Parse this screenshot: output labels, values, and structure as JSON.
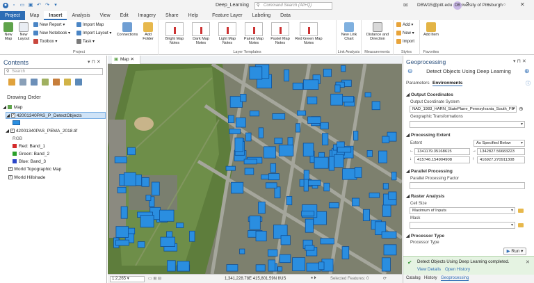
{
  "window": {
    "title": "Deep_Learning",
    "search_placeholder": "Command Search (Alt+Q)",
    "user": "DBW15@pitt.edu - University of Pittsburgh",
    "avatar_initials": "DB"
  },
  "ribbon_tabs": [
    "Project",
    "Map",
    "Insert",
    "Analysis",
    "View",
    "Edit",
    "Imagery",
    "Share",
    "Help",
    "Feature Layer",
    "Labeling",
    "Data"
  ],
  "active_tab": "Insert",
  "ribbon": {
    "project": {
      "new_map": "New Map",
      "new_layout": "New Layout",
      "new_report": "New Report",
      "new_notebook": "New Notebook",
      "toolbox": "Toolbox",
      "import_map": "Import Map",
      "import_layout": "Import Layout",
      "task": "Task",
      "connections": "Connections",
      "add_folder": "Add Folder",
      "group_label": "Project"
    },
    "layer_templates": {
      "items": [
        "Bright Map Notes",
        "Dark Map Notes",
        "Light Map Notes",
        "Paired Map Notes",
        "Pastel Map Notes",
        "Red Green Map Notes"
      ],
      "group_label": "Layer Templates"
    },
    "link_analysis": {
      "new_link_chart": "New Link Chart",
      "group_label": "Link Analysis"
    },
    "measurements": {
      "distance_direction": "Distance and Direction",
      "group_label": "Measurements"
    },
    "styles": {
      "add": "Add",
      "new": "New",
      "import": "Import",
      "group_label": "Styles"
    },
    "favorites": {
      "add_item": "Add Item",
      "group_label": "Favorites"
    }
  },
  "contents": {
    "title": "Contents",
    "search_placeholder": "Search",
    "drawing_order": "Drawing Order",
    "layers": {
      "map": "Map",
      "detect_objects": "42001340PAS_P_DetectObjects",
      "imagery": "42001340PAS_PEMA_2018.tif",
      "rgb": "RGB",
      "red": "Red: Band_1",
      "green": "Green: Band_2",
      "blue": "Blue: Band_3",
      "topo": "World Topographic Map",
      "hillshade": "World Hillshade"
    }
  },
  "map_view": {
    "tab": "Map",
    "scale": "1:2,265",
    "coordinates": "1,341,228.78E 415,801.59N ftUS",
    "selected_features": "Selected Features: 0"
  },
  "geoprocessing": {
    "title": "Geoprocessing",
    "tool": "Detect Objects Using Deep Learning",
    "tabs": [
      "Parameters",
      "Environments"
    ],
    "active_tab": "Environments",
    "output_coords": "Output Coordinates",
    "ocs_label": "Output Coordinate System",
    "ocs_value": "NAD_1983_HARN_StatePlane_Pennsylvania_South_FIP",
    "geo_transform": "Geographic Transformations",
    "processing_extent": "Processing Extent",
    "extent_label": "Extent",
    "extent_value": "As Specified Below",
    "left": "1341179.35168615",
    "right": "1342827.56683223",
    "bottom": "415746.154904908",
    "top": "416927.270911308",
    "parallel": "Parallel Processing",
    "parallel_factor": "Parallel Processing Factor",
    "raster_analysis": "Raster Analysis",
    "cell_size": "Cell Size",
    "cell_size_value": "Maximum of Inputs",
    "mask": "Mask",
    "processor_type_section": "Processor Type",
    "processor_type": "Processor Type",
    "run": "Run",
    "msg": "Detect Objects Using Deep Learning completed.",
    "view_details": "View Details",
    "open_history": "Open History",
    "bottom_tabs": [
      "Catalog",
      "History",
      "Geoprocessing"
    ]
  },
  "colors": {
    "accent": "#2d6db5",
    "building": "#2a8ee0",
    "success": "#3c9a3c"
  }
}
